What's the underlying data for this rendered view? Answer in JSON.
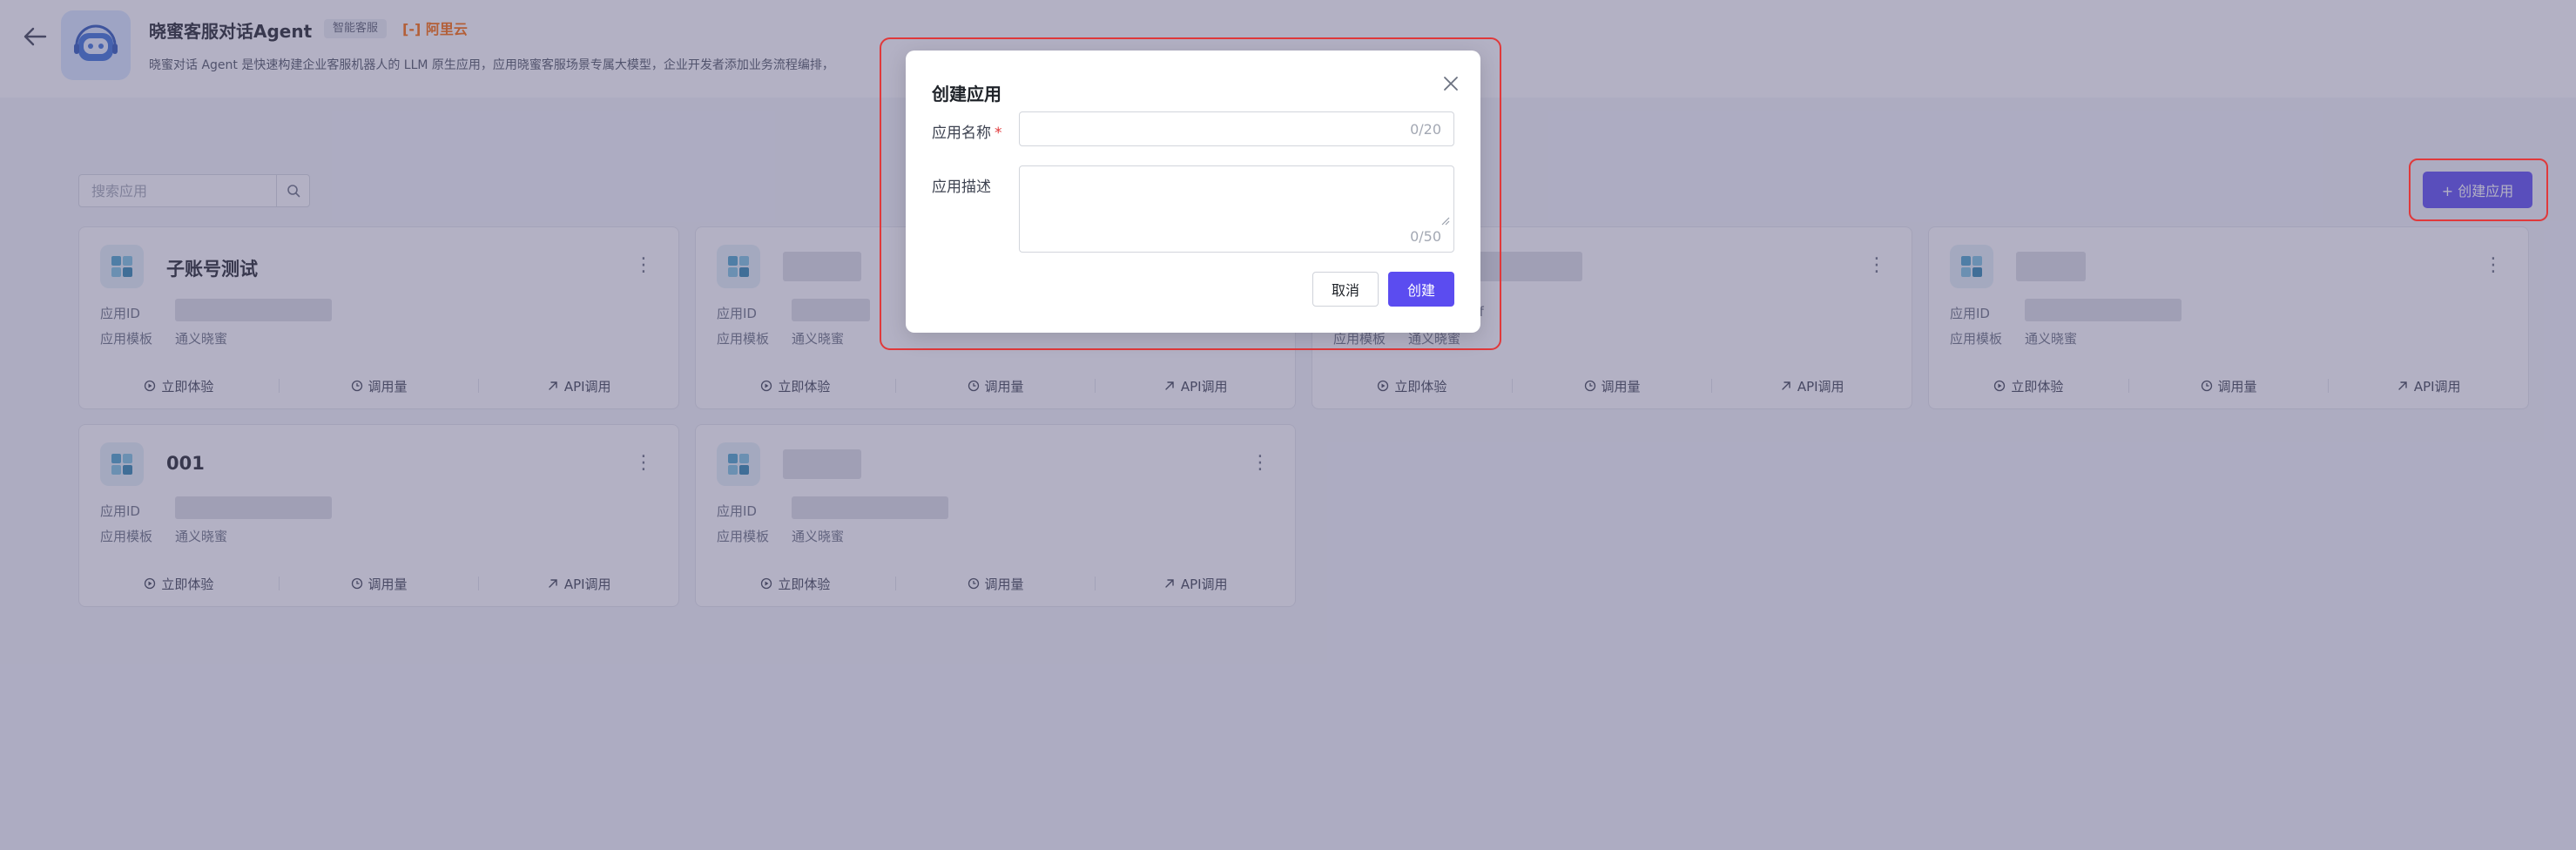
{
  "header": {
    "title": "晓蜜客服对话Agent",
    "tag": "智能客服",
    "brand": "阿里云",
    "description": "晓蜜对话 Agent 是快速构建企业客服机器人的 LLM 原生应用，应用晓蜜客服场景专属大模型，企业开发者添加业务流程编排，"
  },
  "toolbar": {
    "search_placeholder": "搜索应用",
    "create_label": "+ 创建应用"
  },
  "card_labels": {
    "app_id": "应用ID",
    "template": "应用模板",
    "action_try": "立即体验",
    "action_usage": "调用量",
    "action_api": "API调用"
  },
  "cards": [
    {
      "name": "子账号测试",
      "app_id": "",
      "template": "通义晓蜜"
    },
    {
      "name": "",
      "app_id": "",
      "template": "通义晓蜜"
    },
    {
      "name": "",
      "app_id": "-Vnr6ffM2Ff",
      "template": "通义晓蜜"
    },
    {
      "name": "",
      "app_id": "",
      "template": "通义晓蜜"
    },
    {
      "name": "001",
      "app_id": "",
      "template": "通义晓蜜"
    },
    {
      "name": "",
      "app_id": "",
      "template": "通义晓蜜"
    }
  ],
  "modal": {
    "title": "创建应用",
    "name_label": "应用名称",
    "required_mark": "*",
    "name_value": "",
    "name_counter": "0/20",
    "desc_label": "应用描述",
    "desc_value": "",
    "desc_counter": "0/50",
    "cancel_label": "取消",
    "create_label": "创建"
  },
  "colors": {
    "accent": "#5b4cf0",
    "highlight": "#e0393b",
    "brand": "#ff6a00"
  }
}
